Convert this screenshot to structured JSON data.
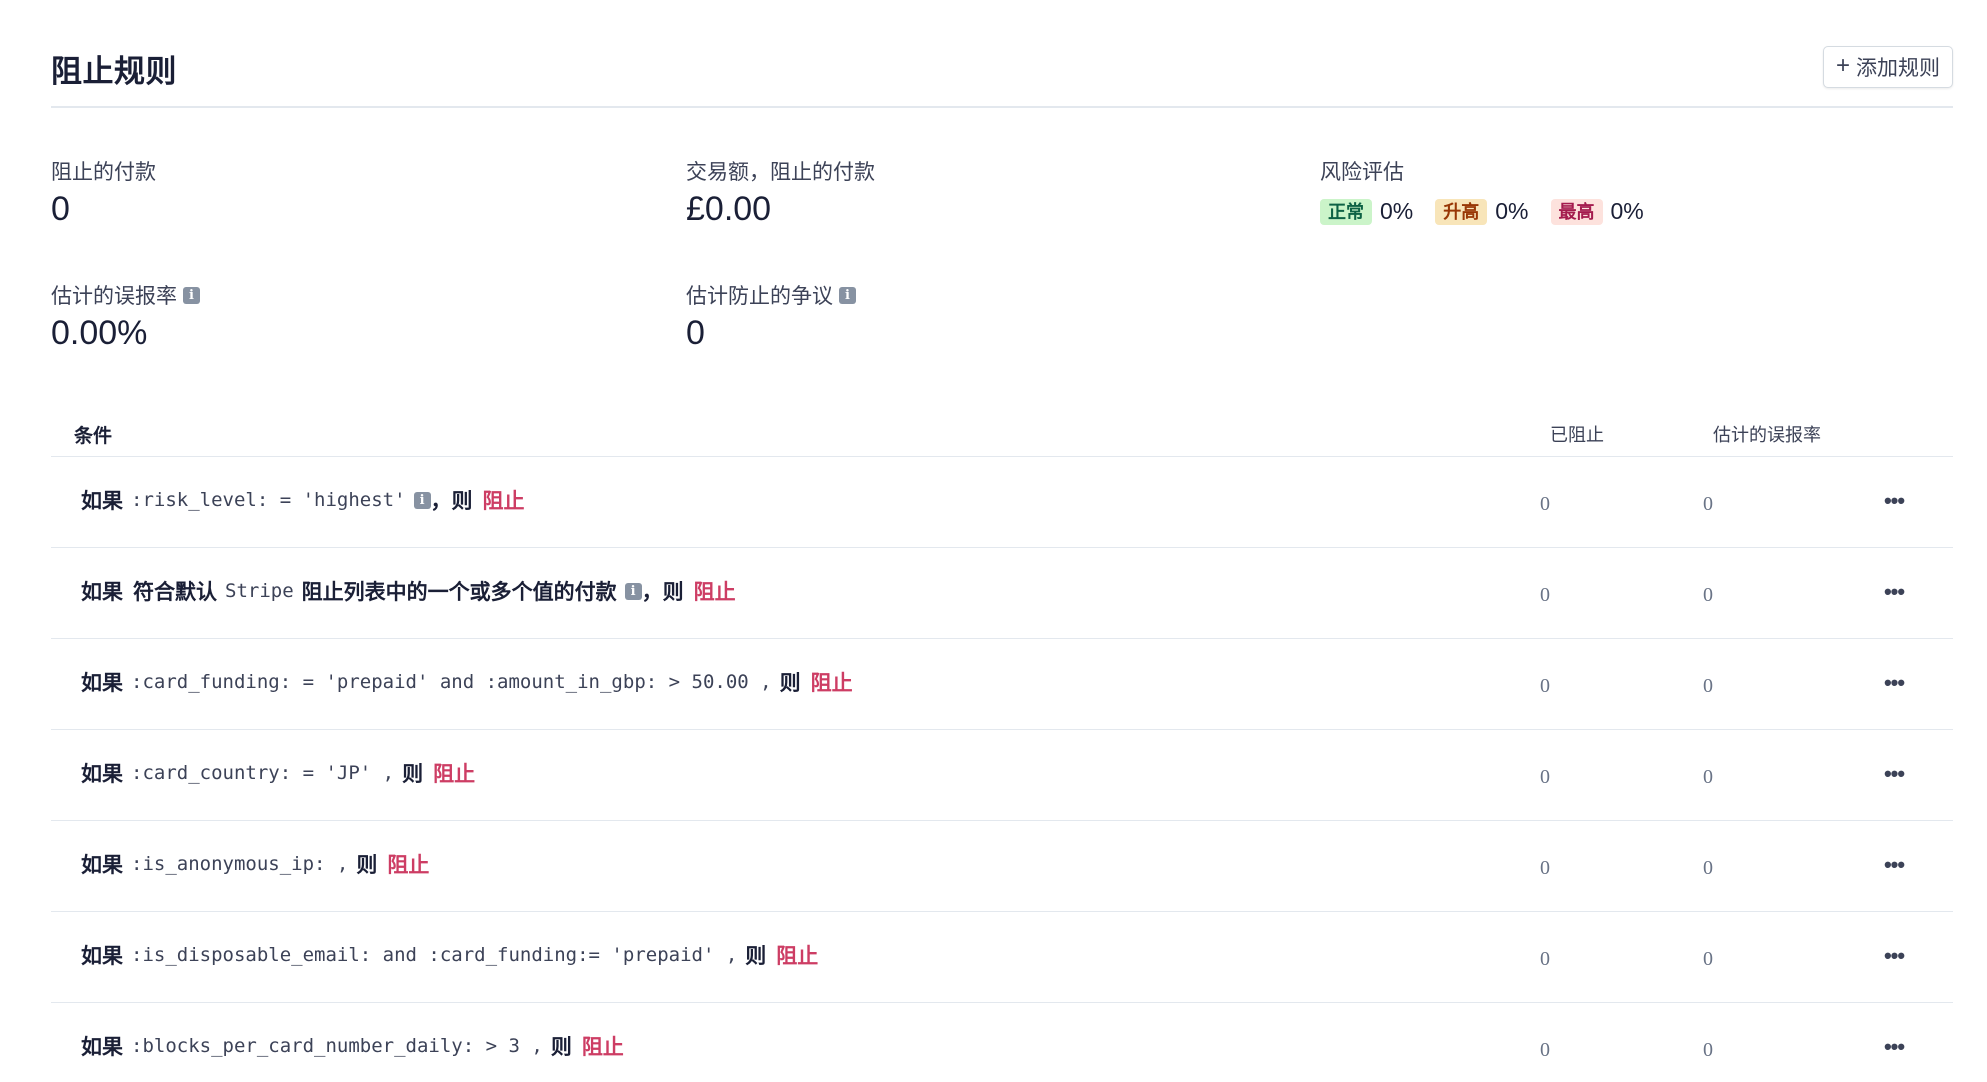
{
  "header": {
    "title": "阻止规则",
    "add_button_label": "添加规则",
    "add_button_icon": "plus-icon"
  },
  "metrics": {
    "blocked_payments": {
      "label": "阻止的付款",
      "value": "0"
    },
    "blocked_volume": {
      "label": "交易额，阻止的付款",
      "value": "£0.00"
    },
    "risk_evaluation": {
      "label": "风险评估",
      "levels": [
        {
          "badge": "正常",
          "percent": "0%",
          "color": "#cbf4c9"
        },
        {
          "badge": "升高",
          "percent": "0%",
          "color": "#f8e5b9"
        },
        {
          "badge": "最高",
          "percent": "0%",
          "color": "#fde2dd"
        }
      ]
    },
    "false_positive_rate": {
      "label": "估计的误报率",
      "value": "0.00%"
    },
    "disputes_prevented": {
      "label": "估计防止的争议",
      "value": "0"
    }
  },
  "table": {
    "headers": {
      "condition": "条件",
      "blocked": "已阻止",
      "fpr": "估计的误报率"
    },
    "rows": [
      {
        "if": "如果",
        "condition": ":risk_level: = 'highest'",
        "mid": "",
        "then": "，则",
        "action": "阻止",
        "blocked": "0",
        "fpr": "0",
        "has_info": true
      },
      {
        "if": "如果",
        "pre": "符合默认",
        "condition": "Stripe",
        "mid": "阻止列表中的一个或多个值的付款",
        "then": "，则",
        "action": "阻止",
        "blocked": "0",
        "fpr": "0",
        "has_info": true
      },
      {
        "if": "如果",
        "condition": ":card_funding: = 'prepaid' and :amount_in_gbp: > 50.00 ,",
        "then": "则",
        "action": "阻止",
        "blocked": "0",
        "fpr": "0"
      },
      {
        "if": "如果",
        "condition": ":card_country: = 'JP' ,",
        "then": "则",
        "action": "阻止",
        "blocked": "0",
        "fpr": "0"
      },
      {
        "if": "如果",
        "condition": ":is_anonymous_ip: ,",
        "then": "则",
        "action": "阻止",
        "blocked": "0",
        "fpr": "0"
      },
      {
        "if": "如果",
        "condition": ":is_disposable_email: and :card_funding:= 'prepaid' ,",
        "then": "则",
        "action": "阻止",
        "blocked": "0",
        "fpr": "0"
      },
      {
        "if": "如果",
        "condition": ":blocks_per_card_number_daily: > 3 ,",
        "then": "则",
        "action": "阻止",
        "blocked": "0",
        "fpr": "0"
      }
    ]
  }
}
